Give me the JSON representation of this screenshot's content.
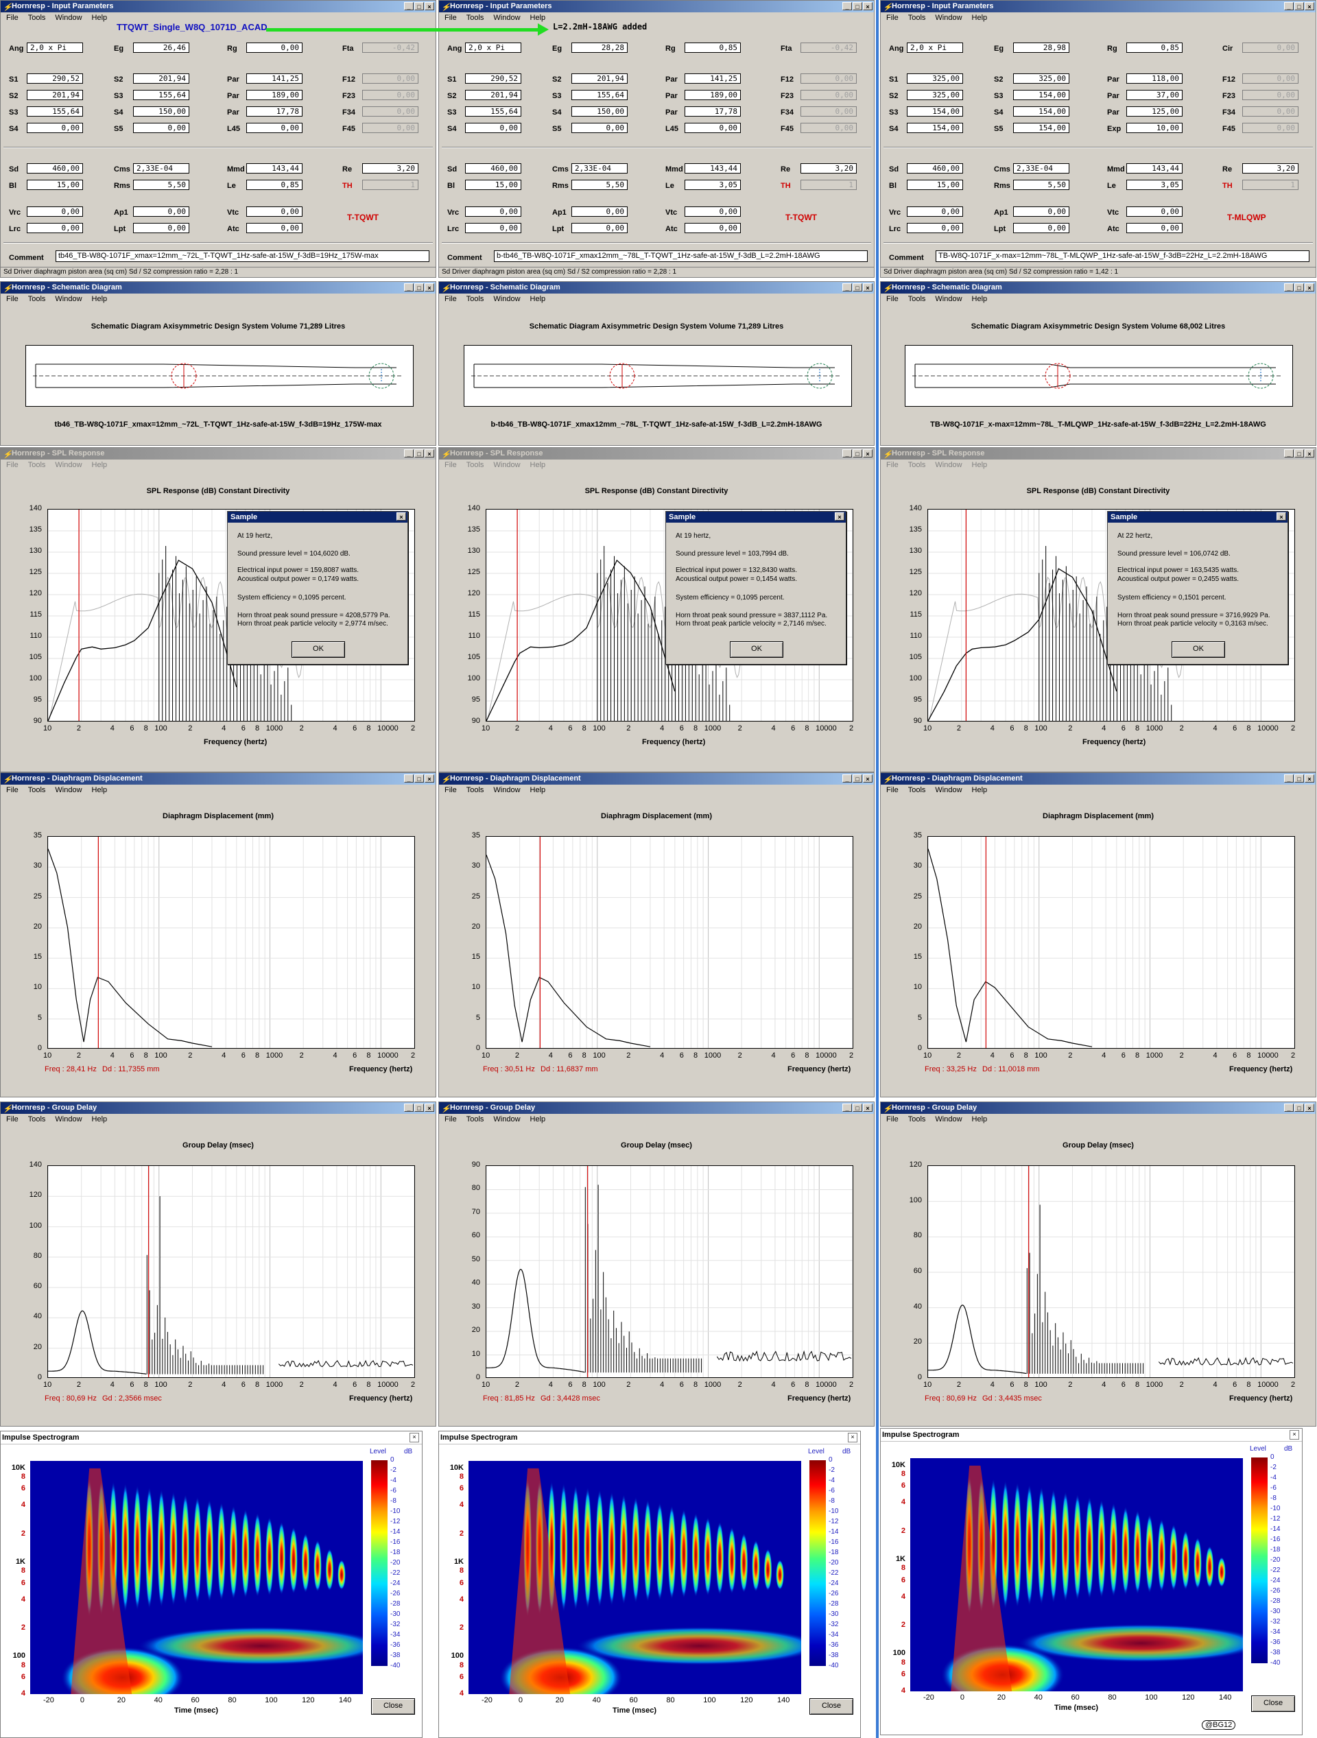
{
  "annotation": {
    "title_note": "TTQWT_Single_W8Q_1071D_ACAD",
    "inductor_note": "L=2.2mH-18AWG added",
    "signature": "@BG12"
  },
  "window_titles": {
    "input": "Hornresp - Input Parameters",
    "schematic": "Hornresp - Schematic Diagram",
    "spl": "Hornresp - SPL Response",
    "displacement": "Hornresp - Diaphragm Displacement",
    "group_delay": "Hornresp - Group Delay",
    "spectrogram": "Impulse Spectrogram"
  },
  "menu": [
    "File",
    "Tools",
    "Window",
    "Help"
  ],
  "title_buttons": [
    "_",
    "□",
    "×"
  ],
  "chart_titles": {
    "schematic": "Schematic Diagram   Axisymmetric Design",
    "spl": "SPL Response (dB)   Constant Directivity",
    "displacement": "Diaphragm Displacement (mm)",
    "group_delay": "Group Delay (msec)"
  },
  "axis_labels": {
    "frequency": "Frequency (hertz)",
    "time": "Time (msec)",
    "level": "Level",
    "db": "dB"
  },
  "freq_ticks": [
    "10",
    "2",
    "4",
    "6",
    "8",
    "100",
    "2",
    "4",
    "6",
    "8",
    "1000",
    "2",
    "4",
    "6",
    "8",
    "10000",
    "2"
  ],
  "spl_y_ticks": [
    "140",
    "135",
    "130",
    "125",
    "120",
    "115",
    "110",
    "105",
    "100",
    "95",
    "90"
  ],
  "disp_y_ticks": [
    "35",
    "30",
    "25",
    "20",
    "15",
    "10",
    "5",
    "0"
  ],
  "spec_y_ticks": [
    {
      "t": "10K",
      "red": false
    },
    {
      "t": "8",
      "red": true
    },
    {
      "t": "6",
      "red": true
    },
    {
      "t": "4",
      "red": true
    },
    {
      "t": "2",
      "red": true
    },
    {
      "t": "1K",
      "red": false
    },
    {
      "t": "8",
      "red": true
    },
    {
      "t": "6",
      "red": true
    },
    {
      "t": "4",
      "red": true
    },
    {
      "t": "2",
      "red": true
    },
    {
      "t": "100",
      "red": false
    },
    {
      "t": "8",
      "red": true
    },
    {
      "t": "6",
      "red": true
    },
    {
      "t": "4",
      "red": true
    }
  ],
  "spec_x_ticks": [
    "-20",
    "0",
    "20",
    "40",
    "60",
    "80",
    "100",
    "120",
    "140"
  ],
  "colorbar_ticks": [
    "0",
    "-2",
    "-4",
    "-6",
    "-8",
    "-10",
    "-12",
    "-14",
    "-16",
    "-18",
    "-20",
    "-22",
    "-24",
    "-26",
    "-28",
    "-30",
    "-32",
    "-34",
    "-36",
    "-38",
    "-40"
  ],
  "dialog": {
    "title": "Sample",
    "ok": "OK",
    "close": "Close"
  },
  "param_labels": {
    "ang": "Ang",
    "eg": "Eg",
    "rg": "Rg",
    "fta": "Fta",
    "cir": "Cir",
    "s1": "S1",
    "s2": "S2",
    "s3": "S3",
    "s4": "S4",
    "s5": "S5",
    "par": "Par",
    "l45": "L45",
    "exp": "Exp",
    "f12": "F12",
    "f23": "F23",
    "f34": "F34",
    "f45": "F45",
    "sd": "Sd",
    "bl": "Bl",
    "cms": "Cms",
    "rms": "Rms",
    "mmd": "Mmd",
    "le": "Le",
    "re": "Re",
    "th": "TH",
    "vrc": "Vrc",
    "lrc": "Lrc",
    "ap1": "Ap1",
    "lpt": "Lpt",
    "vtc": "Vtc",
    "atc": "Atc",
    "comment": "Comment"
  },
  "panels": [
    {
      "params": {
        "ang": "2,0 x Pi",
        "eg": "26,46",
        "rg": "0,00",
        "r0c3_label": "Fta",
        "r0c3": "-0,42",
        "s1": "290,52",
        "s2": "201,94",
        "s3": "155,64",
        "s4": "0,00",
        "c1": [
          "201,94",
          "155,64",
          "150,00",
          "0,00"
        ],
        "c1_labels": [
          "S2",
          "S3",
          "S4",
          "S5"
        ],
        "c2": [
          "141,25",
          "189,00",
          "17,78",
          "0,00"
        ],
        "c2_labels": [
          "Par",
          "Par",
          "Par",
          "L45"
        ],
        "f": [
          "0,00",
          "0,00",
          "0,00",
          "0,00"
        ],
        "sd": "460,00",
        "bl": "15,00",
        "cms": "2,33E-04",
        "rms": "5,50",
        "mmd": "143,44",
        "le": "0,85",
        "re": "3,20",
        "th": "1",
        "vrc": "0,00",
        "lrc": "0,00",
        "ap1": "0,00",
        "lpt": "0,00",
        "vtc": "0,00",
        "atc": "0,00",
        "type": "T-TQWT",
        "comment": "tb46_TB-W8Q-1071F_xmax=12mm_~72L_T-TQWT_1Hz-safe-at-15W_f-3dB=19Hz_175W-max"
      },
      "status": "Sd   Driver diaphragm piston area  (sq cm)   Sd / S2 compression ratio = 2,28 : 1",
      "schematic_volume": "System Volume 71,289 Litres",
      "schematic_caption": "tb46_TB-W8Q-1071F_xmax=12mm_~72L_T-TQWT_1Hz-safe-at-15W_f-3dB=19Hz_175W-max",
      "sample": [
        "At 19 hertz,",
        "Sound pressure level = 104,6020 dB.",
        "Electrical input power = 159,8087 watts.",
        "Acoustical output power = 0,1749 watts.",
        "System efficiency = 0,1095 percent.",
        "Horn throat peak sound pressure = 4208,5779 Pa.",
        "Horn throat peak particle velocity = 2,9774 m/sec."
      ],
      "disp_readout": {
        "freq": "Freq : 28,41 Hz",
        "val": "Dd : 11,7355 mm"
      },
      "gd_readout": {
        "freq": "Freq : 80,69 Hz",
        "val": "Gd : 2,3566 msec"
      },
      "gd_y_ticks": [
        "140",
        "120",
        "100",
        "80",
        "60",
        "40",
        "20",
        "0"
      ]
    },
    {
      "params": {
        "ang": "2,0 x Pi",
        "eg": "28,28",
        "rg": "0,85",
        "r0c3_label": "Fta",
        "r0c3": "-0,42",
        "s1": "290,52",
        "s2": "201,94",
        "s3": "155,64",
        "s4": "0,00",
        "c1": [
          "201,94",
          "155,64",
          "150,00",
          "0,00"
        ],
        "c1_labels": [
          "S2",
          "S3",
          "S4",
          "S5"
        ],
        "c2": [
          "141,25",
          "189,00",
          "17,78",
          "0,00"
        ],
        "c2_labels": [
          "Par",
          "Par",
          "Par",
          "L45"
        ],
        "f": [
          "0,00",
          "0,00",
          "0,00",
          "0,00"
        ],
        "sd": "460,00",
        "bl": "15,00",
        "cms": "2,33E-04",
        "rms": "5,50",
        "mmd": "143,44",
        "le": "3,05",
        "re": "3,20",
        "th": "1",
        "vrc": "0,00",
        "lrc": "0,00",
        "ap1": "0,00",
        "lpt": "0,00",
        "vtc": "0,00",
        "atc": "0,00",
        "type": "T-TQWT",
        "comment": "b-tb46_TB-W8Q-1071F_xmax12mm_~78L_T-TQWT_1Hz-safe-at-15W_f-3dB_L=2.2mH-18AWG"
      },
      "status": "Sd   Driver diaphragm piston area  (sq cm)   Sd / S2 compression ratio = 2,28 : 1",
      "schematic_volume": "System Volume 71,289 Litres",
      "schematic_caption": "b-tb46_TB-W8Q-1071F_xmax12mm_~78L_T-TQWT_1Hz-safe-at-15W_f-3dB_L=2.2mH-18AWG",
      "sample": [
        "At 19 hertz,",
        "Sound pressure level = 103,7994 dB.",
        "Electrical input power = 132,8430 watts.",
        "Acoustical output power = 0,1454 watts.",
        "System efficiency = 0,1095 percent.",
        "Horn throat peak sound pressure = 3837,1112 Pa.",
        "Horn throat peak particle velocity = 2,7146 m/sec."
      ],
      "disp_readout": {
        "freq": "Freq : 30,51 Hz",
        "val": "Dd : 11,6837 mm"
      },
      "gd_readout": {
        "freq": "Freq : 81,85 Hz",
        "val": "Gd : 3,4428 msec"
      },
      "gd_y_ticks": [
        "90",
        "80",
        "70",
        "60",
        "50",
        "40",
        "30",
        "20",
        "10",
        "0"
      ]
    },
    {
      "params": {
        "ang": "2,0 x Pi",
        "eg": "28,98",
        "rg": "0,85",
        "r0c3_label": "Cir",
        "r0c3": "0,00",
        "s1": "325,00",
        "s2": "325,00",
        "s3": "154,00",
        "s4": "154,00",
        "c1": [
          "325,00",
          "154,00",
          "154,00",
          "154,00"
        ],
        "c1_labels": [
          "S2",
          "S3",
          "S4",
          "S5"
        ],
        "c2": [
          "118,00",
          "37,00",
          "125,00",
          "10,00"
        ],
        "c2_labels": [
          "Par",
          "Par",
          "Par",
          "Exp"
        ],
        "f": [
          "0,00",
          "0,00",
          "0,00",
          "0,00"
        ],
        "sd": "460,00",
        "bl": "15,00",
        "cms": "2,33E-04",
        "rms": "5,50",
        "mmd": "143,44",
        "le": "3,05",
        "re": "3,20",
        "th": "1",
        "vrc": "0,00",
        "lrc": "0,00",
        "ap1": "0,00",
        "lpt": "0,00",
        "vtc": "0,00",
        "atc": "0,00",
        "type": "T-MLQWP",
        "comment": "TB-W8Q-1071F_x-max=12mm~78L_T-MLQWP_1Hz-safe-at-15W_f-3dB=22Hz_L=2.2mH-18AWG"
      },
      "status": "Sd   Driver diaphragm piston area  (sq cm)   Sd / S2 compression ratio = 1,42 : 1",
      "schematic_volume": "System Volume 68,002 Litres",
      "schematic_caption": "TB-W8Q-1071F_x-max=12mm~78L_T-MLQWP_1Hz-safe-at-15W_f-3dB=22Hz_L=2.2mH-18AWG",
      "sample": [
        "At 22 hertz,",
        "Sound pressure level = 106,0742 dB.",
        "Electrical input power = 163,5435 watts.",
        "Acoustical output power = 0,2455 watts.",
        "System efficiency = 0,1501 percent.",
        "Horn throat peak sound pressure = 3716,9929 Pa.",
        "Horn throat peak particle velocity = 0,3163 m/sec."
      ],
      "disp_readout": {
        "freq": "Freq : 33,25 Hz",
        "val": "Dd : 11,0018 mm"
      },
      "gd_readout": {
        "freq": "Freq : 80,69 Hz",
        "val": "Gd : 3,4435 msec"
      },
      "gd_y_ticks": [
        "120",
        "100",
        "80",
        "60",
        "40",
        "20",
        "0"
      ]
    }
  ],
  "chart_data": [
    {
      "type": "line",
      "title": "SPL Response (dB)   Constant Directivity",
      "xlabel": "Frequency (hertz)",
      "x_scale": "log",
      "xlim": [
        10,
        20000
      ],
      "ylim": [
        90,
        140
      ],
      "marker_freq": [
        19,
        19,
        22
      ],
      "series": [
        {
          "x": [
            10,
            14,
            18,
            20,
            25,
            30,
            40,
            50,
            60,
            80,
            100,
            150,
            200,
            300,
            500
          ],
          "values": [
            90,
            99,
            105,
            107,
            107.5,
            107,
            107.3,
            108,
            109,
            112,
            118,
            128,
            126,
            118,
            98
          ]
        },
        {
          "x": [
            10,
            14,
            18,
            20,
            25,
            30,
            40,
            50,
            60,
            80,
            100,
            150,
            200,
            300,
            500
          ],
          "values": [
            90,
            98,
            104,
            106,
            107.5,
            107.3,
            107.5,
            108,
            109,
            112,
            118,
            128,
            125,
            117,
            97
          ]
        },
        {
          "x": [
            10,
            14,
            18,
            22,
            25,
            30,
            40,
            50,
            60,
            80,
            100,
            150,
            200,
            300,
            500
          ],
          "values": [
            90,
            97,
            103,
            106,
            107,
            107.3,
            107.5,
            108,
            109,
            111,
            114,
            126,
            124,
            116,
            97
          ]
        }
      ]
    },
    {
      "type": "line",
      "title": "Diaphragm Displacement (mm)",
      "xlabel": "Frequency (hertz)",
      "x_scale": "log",
      "xlim": [
        10,
        20000
      ],
      "ylim": [
        0,
        35
      ],
      "series": [
        {
          "x": [
            10,
            12,
            15,
            18,
            21,
            24,
            28,
            35,
            50,
            80,
            120,
            160,
            200,
            300
          ],
          "values": [
            33,
            29,
            20,
            8,
            1,
            8,
            11.7,
            11,
            7.5,
            4,
            1.5,
            1.2,
            0.8,
            0.2
          ]
        },
        {
          "x": [
            10,
            12,
            15,
            18,
            21,
            25,
            30,
            36,
            50,
            80,
            120,
            160,
            200,
            300
          ],
          "values": [
            32,
            28,
            19,
            7,
            1,
            8,
            11.7,
            11,
            7.5,
            3.5,
            1.5,
            1.2,
            0.8,
            0.2
          ]
        },
        {
          "x": [
            10,
            12,
            15,
            18,
            22,
            26,
            33,
            40,
            55,
            80,
            120,
            160,
            200,
            300
          ],
          "values": [
            33,
            28,
            18,
            7,
            1,
            8,
            11,
            10,
            7,
            3.5,
            1.5,
            1.2,
            0.8,
            0.2
          ]
        }
      ]
    },
    {
      "type": "line",
      "title": "Group Delay (msec)",
      "xlabel": "Frequency (hertz)",
      "x_scale": "log",
      "xlim": [
        10,
        20000
      ],
      "ylims": [
        [
          0,
          140
        ],
        [
          0,
          90
        ],
        [
          0,
          120
        ]
      ],
      "peaks": [
        [
          44,
          81,
          120,
          75
        ],
        [
          46,
          81,
          82,
          85
        ],
        [
          41,
          62,
          98,
          92
        ]
      ]
    }
  ]
}
